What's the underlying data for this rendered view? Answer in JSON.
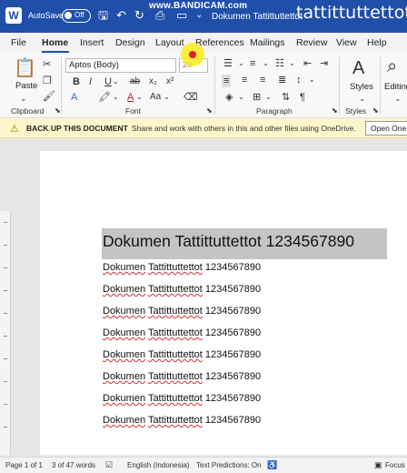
{
  "titlebar": {
    "app_logo": "W",
    "autosave_label": "AutoSave",
    "autosave_state": "Off",
    "doc_title": "Dokumen Tattittuttettot",
    "watermark": "www.BANDICAM.com",
    "overlay_text": "tattittuttettot",
    "icons": [
      "save-icon",
      "undo-icon",
      "redo-icon",
      "refresh-icon",
      "print-icon",
      "dropdown-icon"
    ]
  },
  "tabs": [
    "File",
    "Home",
    "Insert",
    "Design",
    "Layout",
    "References",
    "Mailings",
    "Review",
    "View",
    "Help"
  ],
  "active_tab": "Home",
  "ribbon": {
    "paste_label": "Paste",
    "clipboard_label": "Clipboard",
    "font_name": "Aptos (Body)",
    "font_size": "20",
    "font_label": "Font",
    "paragraph_label": "Paragraph",
    "styles_label": "Styles",
    "styles_group_label": "Styles",
    "editing_label": "Editing",
    "bold": "B",
    "italic": "I",
    "underline": "U",
    "strike": "ab",
    "subscript": "x₂",
    "superscript": "x²",
    "change_case": "Aa",
    "grow": "A",
    "shrink": "A"
  },
  "notification": {
    "title": "BACK UP THIS DOCUMENT",
    "message": "Share and work with others in this and other files using OneDrive.",
    "button": "Open One"
  },
  "document": {
    "heading": "Dokumen Tattittuttettot 1234567890",
    "lines": [
      {
        "word1": "Dokumen",
        "word2": "Tattittuttettot",
        "num": "1234567890"
      },
      {
        "word1": "Dokumen",
        "word2": "Tattittuttettot",
        "num": "1234567890"
      },
      {
        "word1": "Dokumen",
        "word2": "Tattittuttettot",
        "num": "1234567890"
      },
      {
        "word1": "Dokumen",
        "word2": "Tattittuttettot",
        "num": "1234567890"
      },
      {
        "word1": "Dokumen",
        "word2": "Tattittuttettot",
        "num": "1234567890"
      },
      {
        "word1": "Dokumen",
        "word2": "Tattittuttettot",
        "num": "1234567890"
      },
      {
        "word1": "Dokumen",
        "word2": "Tattittuttettot",
        "num": "1234567890"
      },
      {
        "word1": "Dokumen",
        "word2": "Tattittuttettot",
        "num": "1234567890"
      }
    ]
  },
  "status": {
    "page": "Page 1 of 1",
    "words": "3 of 47 words",
    "language": "English (Indonesia)",
    "predictions": "Text Predictions: On",
    "focus": "Focus"
  },
  "colors": {
    "titlebar": "#1f4fa8",
    "notify": "#fdf5cc",
    "highlight": "#c4c4c4"
  }
}
